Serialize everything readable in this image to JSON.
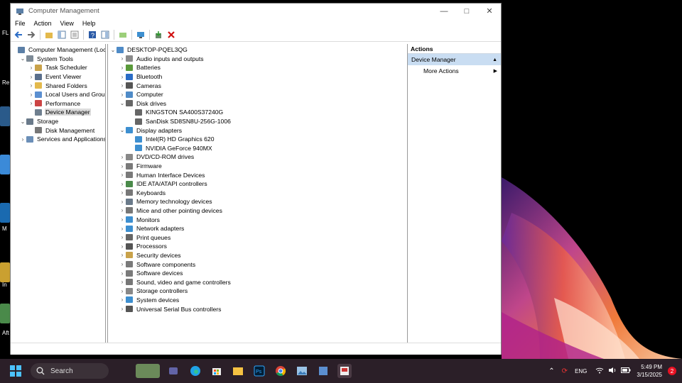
{
  "window": {
    "title": "Computer Management"
  },
  "menu": [
    "File",
    "Action",
    "View",
    "Help"
  ],
  "toolbar_icons": [
    "back-arrow-icon",
    "forward-arrow-icon",
    "folder-up-icon",
    "show-hide-tree-icon",
    "properties-icon",
    "help-icon",
    "details-icon",
    "export-icon",
    "monitor-icon",
    "update-driver-icon",
    "uninstall-x-icon"
  ],
  "left_tree": [
    {
      "label": "Computer Management (Local",
      "level": 0,
      "exp": "",
      "icon": "computer-management-icon",
      "color": "#5b7fa6"
    },
    {
      "label": "System Tools",
      "level": 1,
      "exp": "⌄",
      "icon": "tools-icon",
      "color": "#7d8a96"
    },
    {
      "label": "Task Scheduler",
      "level": 2,
      "exp": "›",
      "icon": "clock-icon",
      "color": "#c9a24a"
    },
    {
      "label": "Event Viewer",
      "level": 2,
      "exp": "›",
      "icon": "event-viewer-icon",
      "color": "#5a6f8c"
    },
    {
      "label": "Shared Folders",
      "level": 2,
      "exp": "›",
      "icon": "shared-folder-icon",
      "color": "#e3b94c"
    },
    {
      "label": "Local Users and Groups",
      "level": 2,
      "exp": "›",
      "icon": "users-icon",
      "color": "#5b8fd0"
    },
    {
      "label": "Performance",
      "level": 2,
      "exp": "›",
      "icon": "performance-icon",
      "color": "#c44"
    },
    {
      "label": "Device Manager",
      "level": 2,
      "exp": "",
      "icon": "device-manager-icon",
      "color": "#6f7f8f",
      "selected": true
    },
    {
      "label": "Storage",
      "level": 1,
      "exp": "⌄",
      "icon": "storage-icon",
      "color": "#6a7a8a"
    },
    {
      "label": "Disk Management",
      "level": 2,
      "exp": "",
      "icon": "disk-icon",
      "color": "#777"
    },
    {
      "label": "Services and Applications",
      "level": 1,
      "exp": "›",
      "icon": "services-icon",
      "color": "#6b8fb8"
    }
  ],
  "device_tree": [
    {
      "label": "DESKTOP-PQEL3QG",
      "level": 0,
      "exp": "⌄",
      "icon": "computer-icon",
      "color": "#4f8bc7"
    },
    {
      "label": "Audio inputs and outputs",
      "level": 1,
      "exp": "›",
      "icon": "speaker-icon",
      "color": "#8a8a8a"
    },
    {
      "label": "Batteries",
      "level": 1,
      "exp": "›",
      "icon": "battery-icon",
      "color": "#5a9a3a"
    },
    {
      "label": "Bluetooth",
      "level": 1,
      "exp": "›",
      "icon": "bluetooth-icon",
      "color": "#2a6cc6"
    },
    {
      "label": "Cameras",
      "level": 1,
      "exp": "›",
      "icon": "camera-icon",
      "color": "#555"
    },
    {
      "label": "Computer",
      "level": 1,
      "exp": "›",
      "icon": "computer-icon",
      "color": "#4f8bc7"
    },
    {
      "label": "Disk drives",
      "level": 1,
      "exp": "⌄",
      "icon": "disk-drive-icon",
      "color": "#666"
    },
    {
      "label": "KINGSTON SA400S37240G",
      "level": 2,
      "exp": "",
      "icon": "disk-drive-icon",
      "color": "#666"
    },
    {
      "label": "SanDisk SD8SN8U-256G-1006",
      "level": 2,
      "exp": "",
      "icon": "disk-drive-icon",
      "color": "#666"
    },
    {
      "label": "Display adapters",
      "level": 1,
      "exp": "⌄",
      "icon": "display-adapter-icon",
      "color": "#3d8fd0"
    },
    {
      "label": "Intel(R) HD Graphics 620",
      "level": 2,
      "exp": "",
      "icon": "display-adapter-icon",
      "color": "#3d8fd0"
    },
    {
      "label": "NVIDIA GeForce 940MX",
      "level": 2,
      "exp": "",
      "icon": "display-adapter-icon",
      "color": "#3d8fd0"
    },
    {
      "label": "DVD/CD-ROM drives",
      "level": 1,
      "exp": "›",
      "icon": "dvd-icon",
      "color": "#888"
    },
    {
      "label": "Firmware",
      "level": 1,
      "exp": "›",
      "icon": "firmware-icon",
      "color": "#7a7a7a"
    },
    {
      "label": "Human Interface Devices",
      "level": 1,
      "exp": "›",
      "icon": "hid-icon",
      "color": "#7a7a7a"
    },
    {
      "label": "IDE ATA/ATAPI controllers",
      "level": 1,
      "exp": "›",
      "icon": "ide-controller-icon",
      "color": "#4a8a4a"
    },
    {
      "label": "Keyboards",
      "level": 1,
      "exp": "›",
      "icon": "keyboard-icon",
      "color": "#777"
    },
    {
      "label": "Memory technology devices",
      "level": 1,
      "exp": "›",
      "icon": "memory-icon",
      "color": "#6a7a8a"
    },
    {
      "label": "Mice and other pointing devices",
      "level": 1,
      "exp": "›",
      "icon": "mouse-icon",
      "color": "#777"
    },
    {
      "label": "Monitors",
      "level": 1,
      "exp": "›",
      "icon": "monitor-icon",
      "color": "#3d8fd0"
    },
    {
      "label": "Network adapters",
      "level": 1,
      "exp": "›",
      "icon": "network-adapter-icon",
      "color": "#3d8fd0"
    },
    {
      "label": "Print queues",
      "level": 1,
      "exp": "›",
      "icon": "printer-icon",
      "color": "#666"
    },
    {
      "label": "Processors",
      "level": 1,
      "exp": "›",
      "icon": "processor-icon",
      "color": "#555"
    },
    {
      "label": "Security devices",
      "level": 1,
      "exp": "›",
      "icon": "security-icon",
      "color": "#c9a24a"
    },
    {
      "label": "Software components",
      "level": 1,
      "exp": "›",
      "icon": "software-component-icon",
      "color": "#7a7a7a"
    },
    {
      "label": "Software devices",
      "level": 1,
      "exp": "›",
      "icon": "software-device-icon",
      "color": "#7a7a7a"
    },
    {
      "label": "Sound, video and game controllers",
      "level": 1,
      "exp": "›",
      "icon": "sound-icon",
      "color": "#777"
    },
    {
      "label": "Storage controllers",
      "level": 1,
      "exp": "›",
      "icon": "storage-controller-icon",
      "color": "#888"
    },
    {
      "label": "System devices",
      "level": 1,
      "exp": "›",
      "icon": "system-devices-icon",
      "color": "#3d8fd0"
    },
    {
      "label": "Universal Serial Bus controllers",
      "level": 1,
      "exp": "›",
      "icon": "usb-icon",
      "color": "#555"
    }
  ],
  "actions": {
    "header": "Actions",
    "selected": "Device Manager",
    "more": "More Actions"
  },
  "taskbar": {
    "search_placeholder": "Search",
    "icons": [
      "widgets-icon",
      "teams-icon",
      "edge-icon",
      "store-icon",
      "file-explorer-icon",
      "photoshop-icon",
      "chrome-icon",
      "photos-icon",
      "app-icon",
      "computer-management-taskbar-icon"
    ],
    "language": "ENG",
    "time": "5:49 PM",
    "date": "3/15/2025",
    "notifications": "2"
  },
  "desktop_labels": [
    "FL",
    "Re",
    "M",
    "In",
    "Aft"
  ],
  "colors": {
    "selected_action": "#c9ddf2",
    "taskbar": "#2b1f28"
  }
}
